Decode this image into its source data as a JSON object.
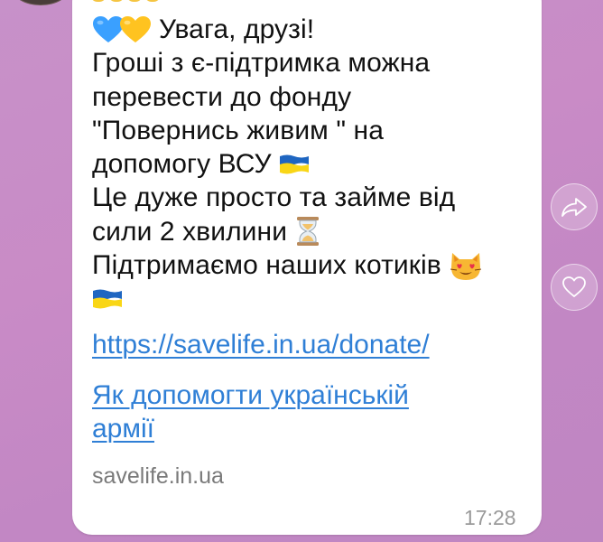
{
  "message": {
    "greeting": "Увага, друзі!",
    "line1": "Гроші з є-підтримка можна",
    "line2": "перевести до фонду",
    "line3": "\"Повернись живим \" на",
    "line4": "допомогу ВСУ ",
    "line5": "Це дуже просто та займе від",
    "line6": "сили 2 хвилини ",
    "line7": "Підтримаємо наших котиків "
  },
  "links": {
    "donate_url": "https://savelife.in.ua/donate/",
    "preview_title_line1": "Як допомогти українській",
    "preview_title_line2": "армії"
  },
  "preview": {
    "domain": "savelife.in.ua"
  },
  "meta": {
    "time": "17:28"
  },
  "icons": {
    "greeting": [
      "blue-heart-icon",
      "yellow-heart-icon"
    ],
    "flag": "ukraine-flag-icon",
    "hourglass": "hourglass-icon",
    "cat": "heart-eyes-cat-icon",
    "share": "share-icon",
    "like": "heart-outline-icon"
  },
  "colors": {
    "link": "#2f7fd6",
    "blue_heart": "#3aa0ff",
    "yellow_heart": "#ffc320",
    "flag_blue": "#1f66c1",
    "flag_yellow": "#f9d616",
    "background": "#c98bc6"
  }
}
